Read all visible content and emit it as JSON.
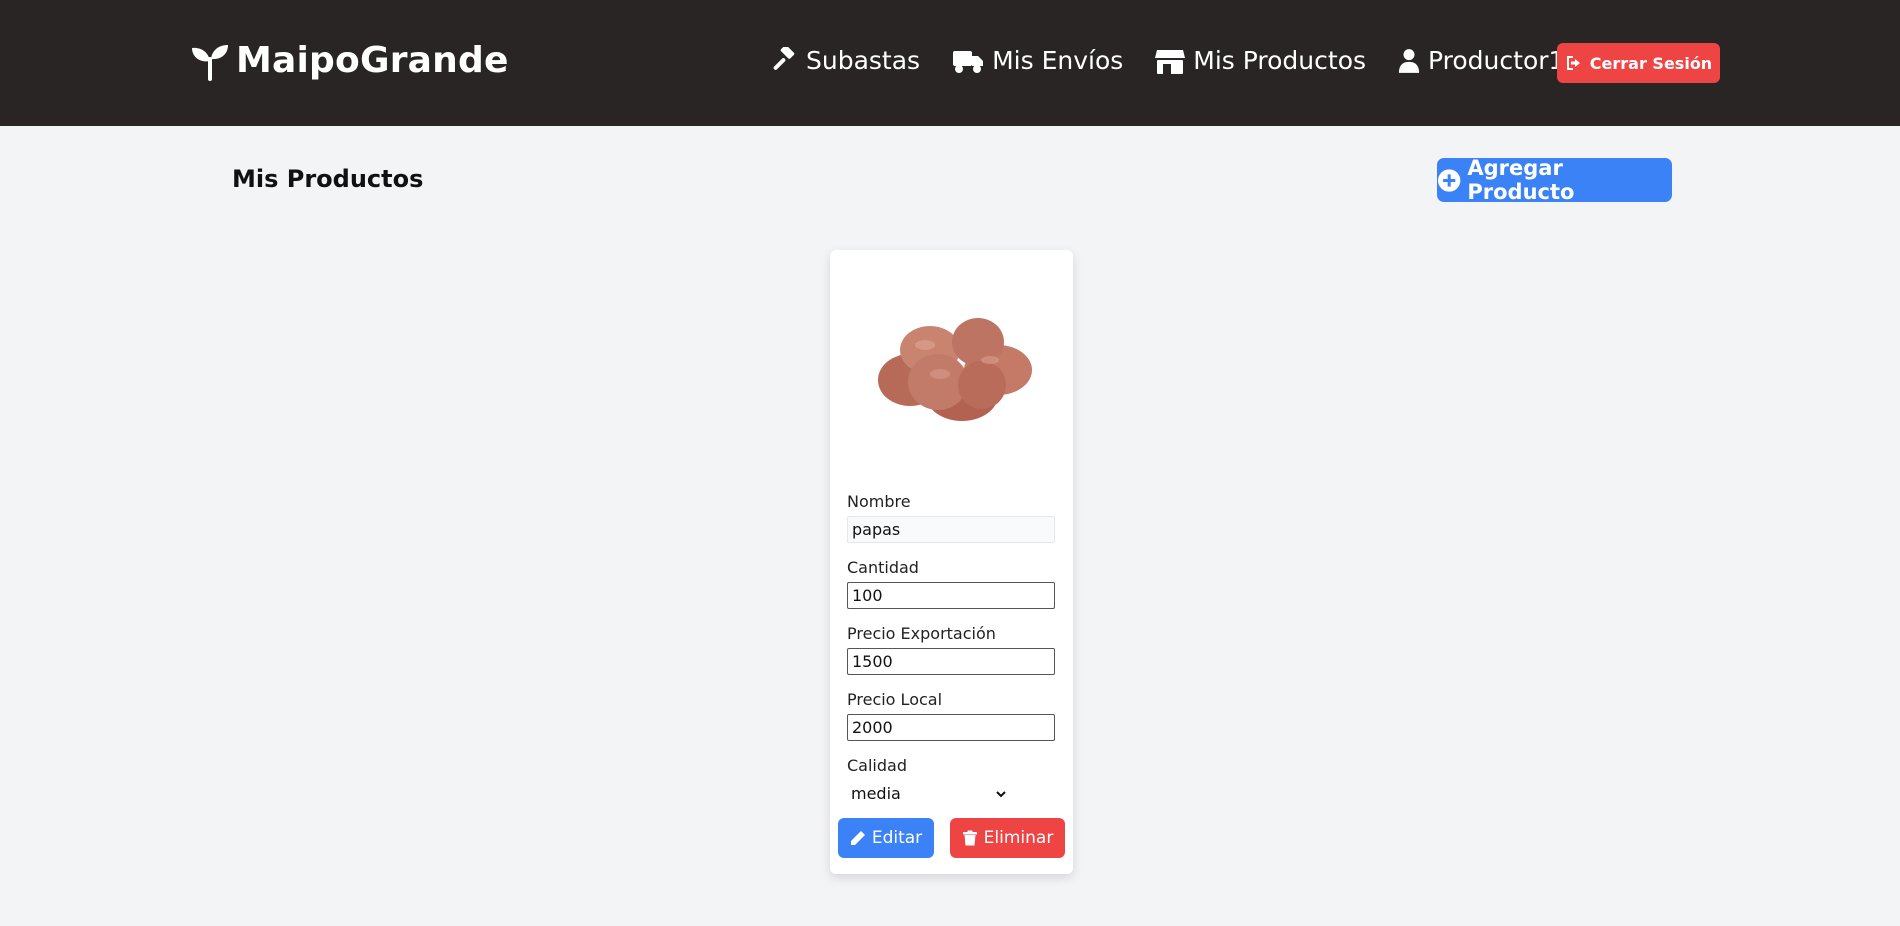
{
  "header": {
    "brand": "MaipoGrande",
    "nav": [
      {
        "label": "Subastas",
        "icon": "gavel-icon"
      },
      {
        "label": "Mis Envíos",
        "icon": "truck-icon"
      },
      {
        "label": "Mis Productos",
        "icon": "store-icon"
      },
      {
        "label": "Productor1",
        "icon": "user-icon"
      }
    ],
    "logout_label": "Cerrar Sesión"
  },
  "main": {
    "title": "Mis Productos",
    "add_label": "Agregar Producto"
  },
  "product": {
    "image": "potatoes-image",
    "fields": {
      "nombre": {
        "label": "Nombre",
        "value": "papas"
      },
      "cantidad": {
        "label": "Cantidad",
        "value": "100"
      },
      "precio_exportacion": {
        "label": "Precio Exportación",
        "value": "1500"
      },
      "precio_local": {
        "label": "Precio Local",
        "value": "2000"
      },
      "calidad": {
        "label": "Calidad",
        "value": "media"
      }
    },
    "edit_label": "Editar",
    "delete_label": "Eliminar"
  },
  "colors": {
    "navbar": "#292524",
    "primary": "#3b82f6",
    "danger": "#ef4444",
    "background": "#f3f4f6"
  }
}
